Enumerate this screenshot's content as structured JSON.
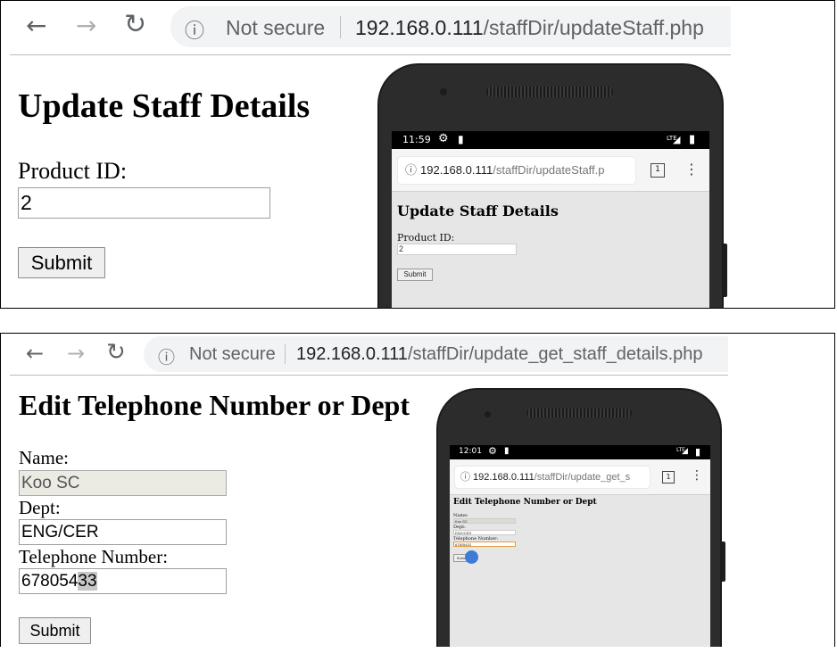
{
  "icons": {
    "back": "←",
    "forward": "→",
    "reload": "↻",
    "info": "ⓘ",
    "settings": "⚙",
    "sdcard": "▮",
    "signal": "◢",
    "battery": "▮",
    "menu": "⋮"
  },
  "panel1": {
    "browser": {
      "not_secure": "Not secure",
      "url_host": "192.168.0.111",
      "url_path": "/staffDir/updateStaff.php"
    },
    "page": {
      "heading": "Update Staff Details",
      "product_id_label": "Product ID:",
      "product_id_value": "2",
      "submit_label": "Submit"
    },
    "phone": {
      "time": "11:59",
      "network": "LTE",
      "url_host": "192.168.0.111",
      "url_path": "/staffDir/updateStaff.p",
      "tab_count": "1",
      "heading": "Update Staff Details",
      "product_id_label": "Product ID:",
      "product_id_value": "2",
      "submit_label": "Submit"
    }
  },
  "panel2": {
    "browser": {
      "not_secure": "Not secure",
      "url_host": "192.168.0.111",
      "url_path": "/staffDir/update_get_staff_details.php"
    },
    "page": {
      "heading": "Edit Telephone Number or Dept",
      "name_label": "Name:",
      "name_value": "Koo SC",
      "dept_label": "Dept:",
      "dept_value": "ENG/CER",
      "tel_label": "Telephone Number:",
      "tel_value_plain": "678054",
      "tel_value_selected": "33",
      "submit_label": "Submit"
    },
    "phone": {
      "time": "12:01",
      "network": "LTE",
      "url_host": "192.168.0.111",
      "url_path": "/staffDir/update_get_s",
      "tab_count": "1",
      "heading": "Edit Telephone Number or Dept",
      "name_label": "Name:",
      "name_value": "Koo SC",
      "dept_label": "Dept:",
      "dept_value": "ENG/CER",
      "tel_label": "Telephone Number:",
      "tel_value": "67805433",
      "submit_label": "Submit"
    }
  }
}
